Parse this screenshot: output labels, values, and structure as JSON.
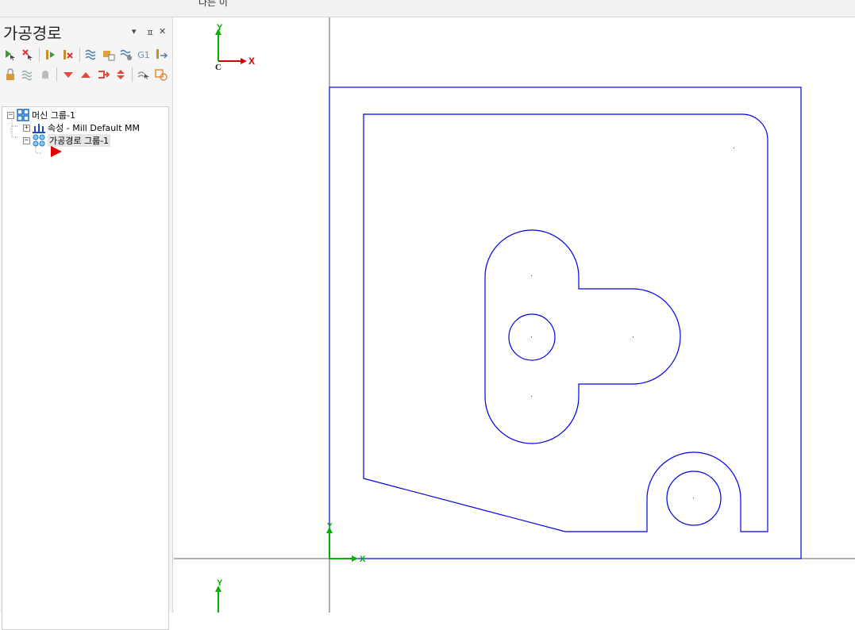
{
  "topbar": {
    "cut_label": "다른 이"
  },
  "panel": {
    "title": "가공경로",
    "controls": {
      "dropdown": "▾",
      "pin": "ㅍ",
      "close": "✕"
    },
    "toolbar_row1": [
      {
        "icon": "select-all-arrow-icon"
      },
      {
        "icon": "deselect-arrow-icon"
      },
      {
        "icon": "select-operations-icon"
      },
      {
        "icon": "deselect-operations-icon"
      },
      {
        "icon": "regenerate-all-icon"
      },
      {
        "icon": "regenerate-dirty-icon"
      },
      {
        "icon": "backplot-icon"
      },
      {
        "icon": "g1-verify-icon",
        "text": "G1"
      },
      {
        "icon": "post-selected-icon"
      }
    ],
    "toolbar_row2": [
      {
        "icon": "lock-icon"
      },
      {
        "icon": "toggle-display-icon"
      },
      {
        "icon": "ghost-icon"
      },
      {
        "icon": "move-down-icon"
      },
      {
        "icon": "move-up-icon"
      },
      {
        "icon": "insert-after-icon"
      },
      {
        "icon": "move-updown-icon"
      },
      {
        "icon": "scroll-insert-arrow-icon"
      },
      {
        "icon": "help-icon"
      }
    ],
    "tree": {
      "machine_group": "머신 그룹-1",
      "properties": "속성 - Mill Default MM",
      "toolpath_group": "가공경로 그룹-1"
    }
  },
  "viewport": {
    "axis_labels": {
      "x": "X",
      "y": "Y",
      "c": "C"
    },
    "colors": {
      "geometry": "#0000e6",
      "axis_x": "#d40000",
      "axis_y": "#00b000",
      "grid": "#606060",
      "insert_marker": "#e00000"
    }
  }
}
